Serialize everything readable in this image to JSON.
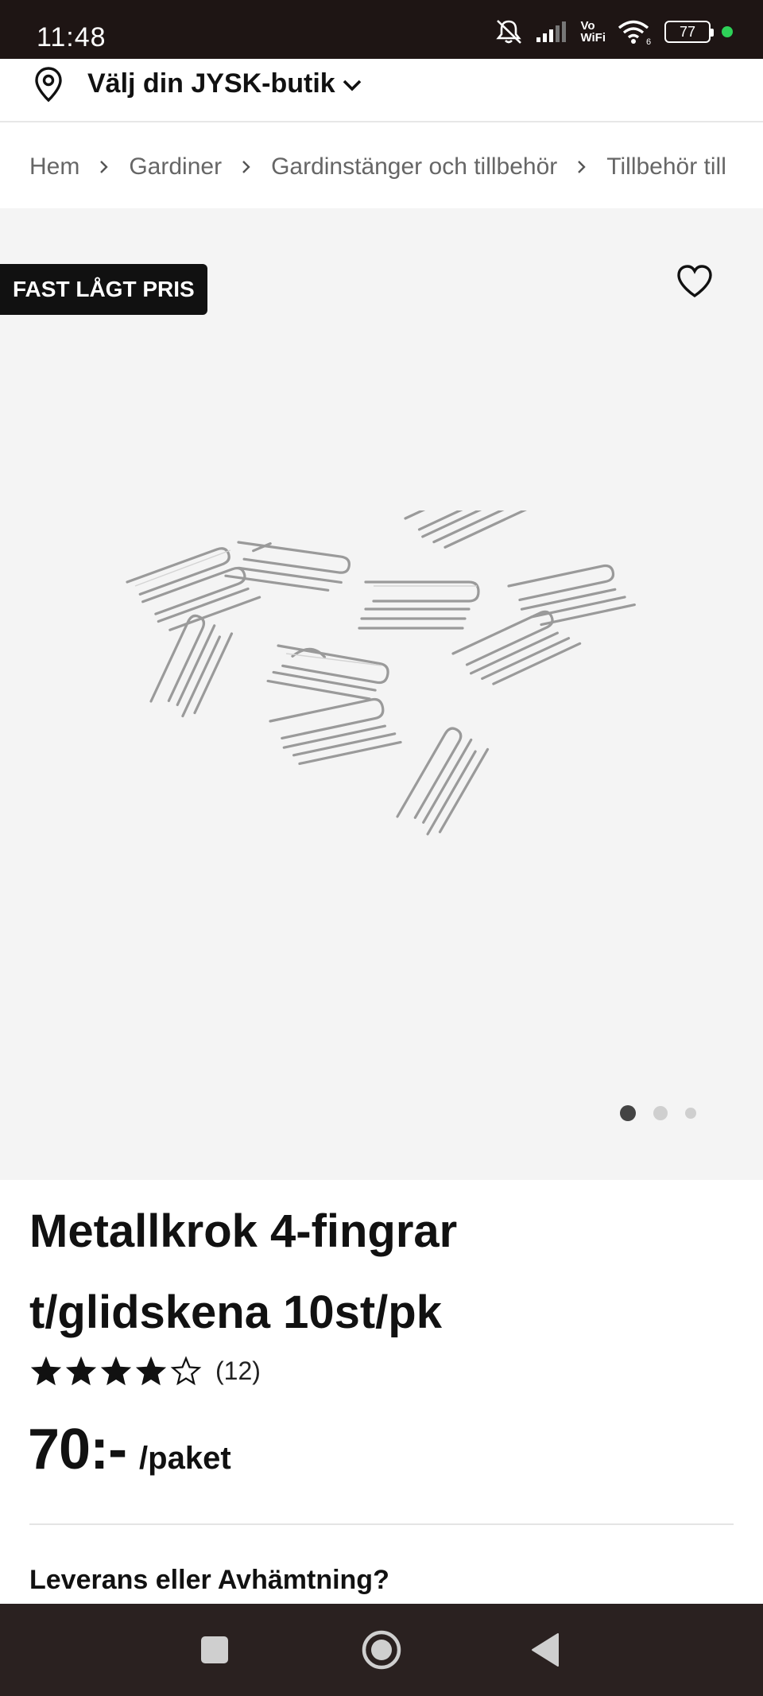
{
  "status_bar": {
    "time": "11:48",
    "network_label_top": "Vo",
    "network_label_bottom": "WiFi",
    "wifi_sub": "6",
    "battery": "77",
    "icons": [
      "mute-icon",
      "signal-icon",
      "wifi-icon",
      "battery-icon"
    ]
  },
  "store_selector": {
    "label": "Välj din JYSK-butik",
    "icon": "location-pin-icon"
  },
  "breadcrumb": [
    "Hem",
    "Gardiner",
    "Gardinstänger och tillbehör",
    "Tillbehör till"
  ],
  "gallery": {
    "badge": "FAST LÅGT PRIS",
    "image_count": 3,
    "active_image": 1
  },
  "product": {
    "title_line1": "Metallkrok 4-fingrar",
    "title_line2": "t/glidskena 10st/pk",
    "rating": 4,
    "rating_max": 5,
    "review_count": "(12)",
    "price": "70:-",
    "price_unit": "/paket"
  },
  "delivery": {
    "title": "Leverans eller Avhämtning?"
  },
  "colors": {
    "status_bar_bg": "#1e1514",
    "nav_bar_bg": "#2a2120",
    "gallery_bg": "#f4f4f4",
    "badge_bg": "#111111",
    "text": "#111111",
    "muted": "#666666"
  }
}
